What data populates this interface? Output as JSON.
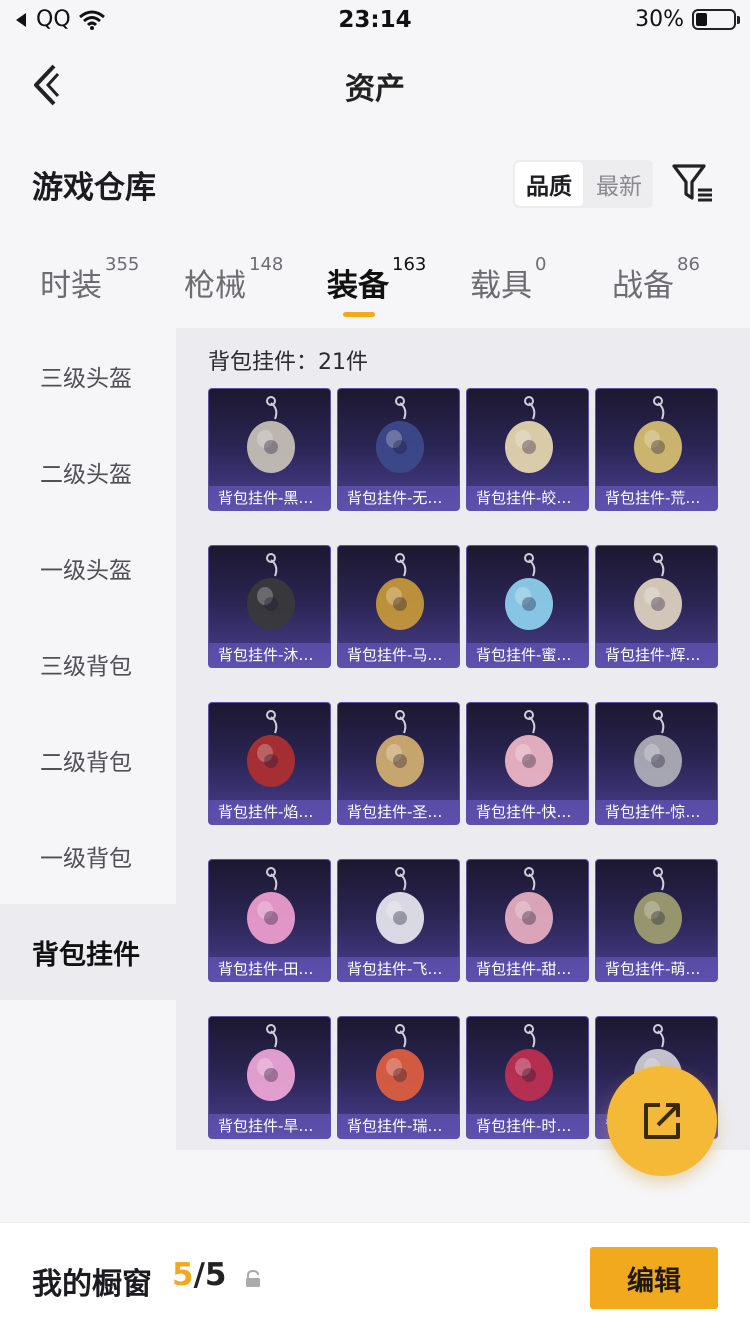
{
  "status_bar": {
    "carrier": "QQ",
    "time": "23:14",
    "battery": "30%",
    "battery_level": 0.3
  },
  "nav": {
    "title": "资产"
  },
  "header": {
    "section_title": "游戏仓库",
    "sort_options": [
      {
        "label": "品质",
        "active": true
      },
      {
        "label": "最新",
        "active": false
      }
    ]
  },
  "tabs": [
    {
      "label": "时装",
      "count": "355"
    },
    {
      "label": "枪械",
      "count": "148"
    },
    {
      "label": "装备",
      "count": "163",
      "active": true
    },
    {
      "label": "载具",
      "count": "0"
    },
    {
      "label": "战备",
      "count": "86"
    }
  ],
  "categories": [
    {
      "label": "三级头盔"
    },
    {
      "label": "二级头盔"
    },
    {
      "label": "一级头盔"
    },
    {
      "label": "三级背包"
    },
    {
      "label": "二级背包"
    },
    {
      "label": "一级背包"
    },
    {
      "label": "背包挂件",
      "active": true
    }
  ],
  "panel": {
    "count_text": "背包挂件：21件"
  },
  "items": [
    {
      "name": "背包挂件-黑…",
      "icon": "bone-charm-icon"
    },
    {
      "name": "背包挂件-无…",
      "icon": "dark-gem-charm-icon"
    },
    {
      "name": "背包挂件-皎…",
      "icon": "moon-charm-icon"
    },
    {
      "name": "背包挂件-荒…",
      "icon": "sun-charm-icon"
    },
    {
      "name": "背包挂件-沐…",
      "icon": "cat-charm-icon"
    },
    {
      "name": "背包挂件-马…",
      "icon": "rocking-horse-charm-icon"
    },
    {
      "name": "背包挂件-蜜…",
      "icon": "heart-charm-icon"
    },
    {
      "name": "背包挂件-辉…",
      "icon": "crystal-charm-icon"
    },
    {
      "name": "背包挂件-焰…",
      "icon": "knot-charm-icon"
    },
    {
      "name": "背包挂件-圣…",
      "icon": "holy-gem-charm-icon"
    },
    {
      "name": "背包挂件-快…",
      "icon": "donut-charm-icon"
    },
    {
      "name": "背包挂件-惊…",
      "icon": "tassel-charm-icon"
    },
    {
      "name": "背包挂件-田…",
      "icon": "card-charm-icon"
    },
    {
      "name": "背包挂件-飞…",
      "icon": "winged-eye-charm-icon"
    },
    {
      "name": "背包挂件-甜…",
      "icon": "umbrella-charm-icon"
    },
    {
      "name": "背包挂件-萌…",
      "icon": "zongzi-charm-icon"
    },
    {
      "name": "背包挂件-旱…",
      "icon": "roller-skate-charm-icon"
    },
    {
      "name": "背包挂件-瑞…",
      "icon": "lantern-charm-icon"
    },
    {
      "name": "背包挂件-时…",
      "icon": "crown-charm-icon"
    },
    {
      "name": "背包挂件-…",
      "icon": "charm-icon"
    }
  ],
  "showcase": {
    "label": "我的橱窗",
    "current": "5",
    "separator": "/",
    "total": "5"
  },
  "edit_button": {
    "label": "编辑"
  },
  "colors": {
    "accent": "#f2a91e",
    "fab": "#f5b938",
    "card_bg": "#2a2452"
  }
}
